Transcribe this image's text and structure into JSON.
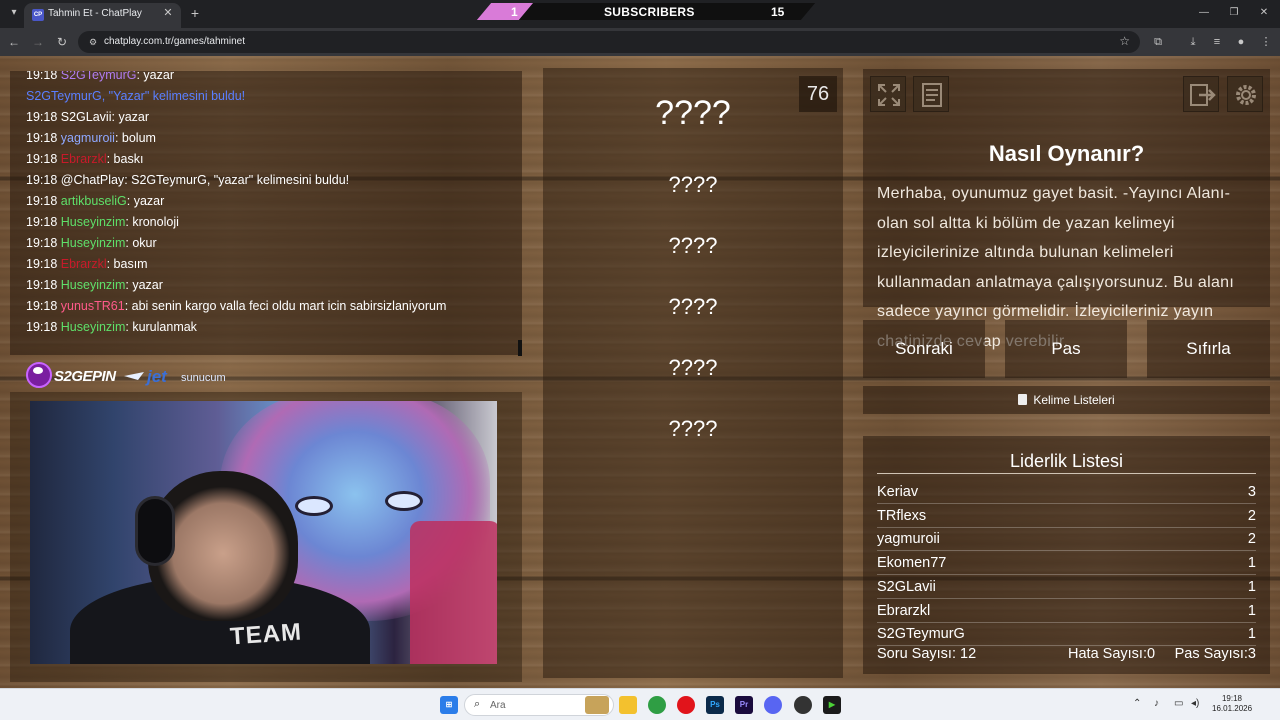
{
  "browser": {
    "tab_title": "Tahmin Et - ChatPlay",
    "tab_favicon": "CP",
    "url": "chatplay.com.tr/games/tahminet",
    "banner": {
      "left_count": "1",
      "label": "SUBSCRIBERS",
      "right_count": "15"
    }
  },
  "chat": {
    "lines": [
      {
        "time": "19:18",
        "user": "S2GTeymurG",
        "user_color": "#b07cf0",
        "msg": ": yazar"
      },
      {
        "time": "",
        "user": "S2GTeymurG, \"Yazar\" kelimesini buldu!",
        "user_color": "#5a7fff",
        "msg": ""
      },
      {
        "time": "19:18",
        "user": "S2GLavii",
        "user_color": "#ffffff",
        "msg": ": yazar"
      },
      {
        "time": "19:18",
        "user": "yagmuroii",
        "user_color": "#8fa8ff",
        "msg": ": bolum"
      },
      {
        "time": "19:18",
        "user": "Ebrarzkl",
        "user_color": "#c81a2a",
        "msg": ": baskı"
      },
      {
        "time": "19:18",
        "user": "@ChatPlay",
        "user_color": "#ffffff",
        "msg": ": S2GTeymurG, \"yazar\" kelimesini buldu!"
      },
      {
        "time": "19:18",
        "user": "artikbuseliG",
        "user_color": "#5fe06a",
        "msg": ": yazar"
      },
      {
        "time": "19:18",
        "user": "Huseyinzim",
        "user_color": "#5fe06a",
        "msg": ": kronoloji"
      },
      {
        "time": "19:18",
        "user": "Huseyinzim",
        "user_color": "#5fe06a",
        "msg": ": okur"
      },
      {
        "time": "19:18",
        "user": "Ebrarzkl",
        "user_color": "#c81a2a",
        "msg": ": basım"
      },
      {
        "time": "19:18",
        "user": "Huseyinzim",
        "user_color": "#5fe06a",
        "msg": ": yazar"
      },
      {
        "time": "19:18",
        "user": "yunusTR61",
        "user_color": "#ff5a8a",
        "msg": ": abi senin kargo valla feci oldu mart icin sabirsizlaniyorum"
      },
      {
        "time": "19:18",
        "user": "Huseyinzim",
        "user_color": "#5fe06a",
        "msg": ": kurulanmak"
      }
    ]
  },
  "logos": {
    "s2g": "S2GEPIN",
    "sponsor_a": "jet",
    "sponsor_b": "sunucum"
  },
  "webcam": {
    "shirt_text": "TEAM"
  },
  "game": {
    "timer": "76",
    "words": [
      "????",
      "????",
      "????",
      "????",
      "????",
      "????"
    ]
  },
  "howto": {
    "title": "Nasıl Oynanır?",
    "text": "Merhaba, oyunumuz gayet basit. -Yayıncı Alanı- olan sol altta ki bölüm de yazan kelimeyi izleyicilerinize altında bulunan kelimeleri kullanmadan anlatmaya çalışıyorsunuz. Bu alanı sadece yayıncı görmelidir. İzleyicileriniz yayın chatinizde cevap verebilir."
  },
  "buttons": {
    "next": "Sonraki",
    "pass": "Pas",
    "reset": "Sıfırla",
    "word_lists": "Kelime Listeleri"
  },
  "leaderboard": {
    "title": "Liderlik Listesi",
    "rows": [
      {
        "name": "Keriav",
        "score": "3"
      },
      {
        "name": "TRflexs",
        "score": "2"
      },
      {
        "name": "yagmuroii",
        "score": "2"
      },
      {
        "name": "Ekomen77",
        "score": "1"
      },
      {
        "name": "S2GLavii",
        "score": "1"
      },
      {
        "name": "Ebrarzkl",
        "score": "1"
      },
      {
        "name": "S2GTeymurG",
        "score": "1"
      }
    ]
  },
  "stats": {
    "questions_label": "Soru Sayısı:",
    "questions": "12",
    "errors_label": "Hata Sayısı:",
    "errors": "0",
    "passes_label": "Pas Sayısı:",
    "passes": "3"
  },
  "taskbar": {
    "search_placeholder": "Ara",
    "time": "19:18",
    "date": "16.01.2026"
  },
  "icons": [
    "start-icon",
    "search-icon",
    "explorer-icon",
    "chrome-icon",
    "opera-icon",
    "photoshop-icon",
    "premiere-icon",
    "discord-icon",
    "obs-icon",
    "terminal-icon"
  ]
}
